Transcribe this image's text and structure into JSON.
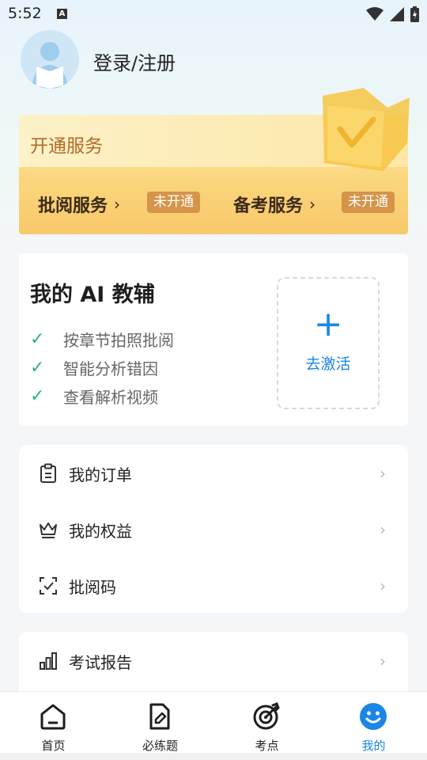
{
  "status_bar": {
    "time": "5:52",
    "notif_letter": "A"
  },
  "profile": {
    "login_label": "登录/注册"
  },
  "service_card": {
    "title": "开通服务",
    "items": [
      {
        "label": "批阅服务",
        "chevron": "›",
        "badge": "未开通"
      },
      {
        "label": "备考服务",
        "chevron": "›",
        "badge": "未开通"
      }
    ]
  },
  "ai_card": {
    "title": "我的 AI 教辅",
    "features": [
      "按章节拍照批阅",
      "智能分析错因",
      "查看解析视频"
    ],
    "activate_label": "去激活",
    "plus": "+"
  },
  "menu_group_1": [
    {
      "icon": "clipboard-icon",
      "label": "我的订单"
    },
    {
      "icon": "crown-icon",
      "label": "我的权益"
    },
    {
      "icon": "scan-check-icon",
      "label": "批阅码"
    }
  ],
  "menu_group_2": [
    {
      "icon": "bar-chart-icon",
      "label": "考试报告"
    }
  ],
  "chevron": "›",
  "check": "✓",
  "tab_bar": {
    "tabs": [
      {
        "icon": "home-icon",
        "label": "首页",
        "active": false
      },
      {
        "icon": "exercise-icon",
        "label": "必练题",
        "active": false
      },
      {
        "icon": "target-icon",
        "label": "考点",
        "active": false
      },
      {
        "icon": "smile-icon",
        "label": "我的",
        "active": true
      }
    ]
  },
  "colors": {
    "accent": "#1a86e6",
    "check": "#2fb67a",
    "badge": "#d4944a",
    "service_title": "#b26a2a"
  }
}
